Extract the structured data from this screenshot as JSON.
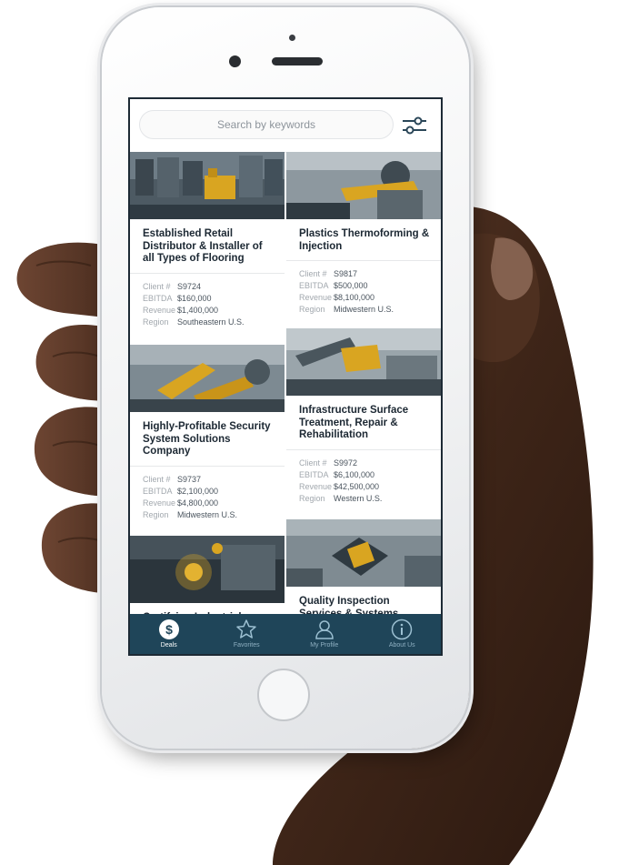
{
  "search": {
    "placeholder": "Search by keywords"
  },
  "cards": [
    {
      "title": "Established Retail Distributor & Installer of all Types of Flooring",
      "stats": [
        {
          "label": "Client #",
          "value": "S9724"
        },
        {
          "label": "EBITDA",
          "value": "$160,000"
        },
        {
          "label": "Revenue",
          "value": "$1,400,000"
        },
        {
          "label": "Region",
          "value": "Southeastern U.S."
        }
      ]
    },
    {
      "title": "Plastics Thermoforming & Injection",
      "stats": [
        {
          "label": "Client #",
          "value": "S9817"
        },
        {
          "label": "EBITDA",
          "value": "$500,000"
        },
        {
          "label": "Revenue",
          "value": "$8,100,000"
        },
        {
          "label": "Region",
          "value": "Midwestern U.S."
        }
      ]
    },
    {
      "title": "Highly-Profitable Security System Solutions Company",
      "stats": [
        {
          "label": "Client #",
          "value": "S9737"
        },
        {
          "label": "EBITDA",
          "value": "$2,100,000"
        },
        {
          "label": "Revenue",
          "value": "$4,800,000"
        },
        {
          "label": "Region",
          "value": "Midwestern U.S."
        }
      ]
    },
    {
      "title": "Infrastructure Surface Treatment, Repair & Rehabilitation",
      "stats": [
        {
          "label": "Client #",
          "value": "S9972"
        },
        {
          "label": "EBITDA",
          "value": "$6,100,000"
        },
        {
          "label": "Revenue",
          "value": "$42,500,000"
        },
        {
          "label": "Region",
          "value": "Western U.S."
        }
      ]
    },
    {
      "title": "Certifying Industrial",
      "stats": []
    },
    {
      "title": "Quality Inspection Services & Systems",
      "stats": []
    }
  ],
  "tabs": [
    {
      "label": "Deals",
      "icon": "dollar-icon",
      "active": true
    },
    {
      "label": "Favorites",
      "icon": "star-icon",
      "active": false
    },
    {
      "label": "My Profile",
      "icon": "profile-icon",
      "active": false
    },
    {
      "label": "About Us",
      "icon": "info-icon",
      "active": false
    }
  ],
  "colors": {
    "tab_bar": "#1f4559",
    "accent_gold": "#d9a521",
    "title_text": "#1c2833"
  }
}
